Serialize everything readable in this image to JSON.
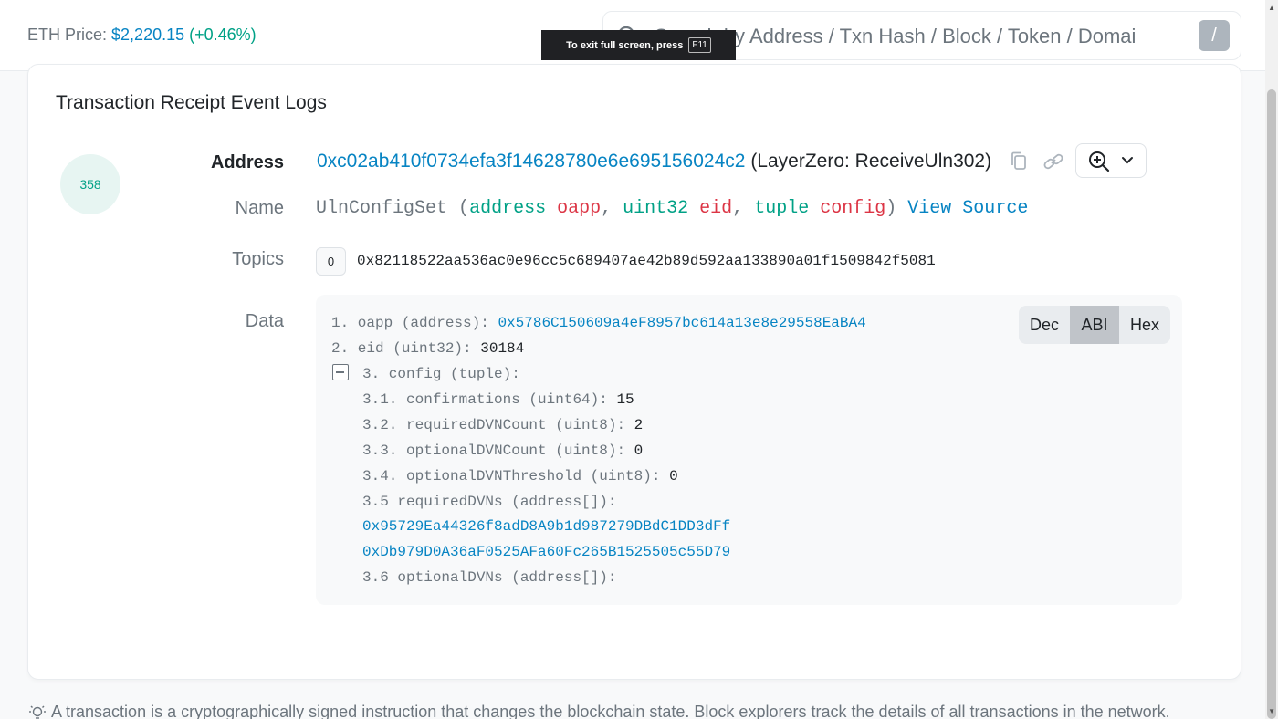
{
  "header": {
    "eth_price_label": "ETH Price:",
    "eth_price_value": "$2,220.15",
    "eth_price_change": "(+0.46%)",
    "search_placeholder": "Search by Address / Txn Hash / Block / Token / Domai",
    "search_shortcut": "/"
  },
  "fullscreen_toast": {
    "text": "To exit full screen, press",
    "key": "F11"
  },
  "card": {
    "title": "Transaction Receipt Event Logs",
    "log_index": "358",
    "labels": {
      "address": "Address",
      "name": "Name",
      "topics": "Topics",
      "data": "Data"
    },
    "address": {
      "hash": "0xc02ab410f0734efa3f14628780e6e695156024c2",
      "tag": "(LayerZero: ReceiveUln302)"
    },
    "name": {
      "event": "UlnConfigSet",
      "open": "(",
      "t1": "address",
      "p1": "oapp",
      "c1": ",",
      "t2": "uint32",
      "p2": "eid",
      "c2": ",",
      "t3": "tuple",
      "p3": "config",
      "close": ")",
      "view_source": "View Source"
    },
    "topics": {
      "index": "0",
      "hash": "0x82118522aa536ac0e96cc5c689407ae42b89d592aa133890a01f1509842f5081"
    },
    "data": {
      "line1_label": "1. oapp (address):",
      "line1_value": "0x5786C150609a4eF8957bc614a13e8e29558EaBA4",
      "line2_label": "2. eid (uint32):",
      "line2_value": "30184",
      "line3_label": "3. config (tuple):",
      "line31_label": "3.1. confirmations (uint64):",
      "line31_value": "15",
      "line32_label": "3.2. requiredDVNCount (uint8):",
      "line32_value": "2",
      "line33_label": "3.3. optionalDVNCount (uint8):",
      "line33_value": "0",
      "line34_label": "3.4. optionalDVNThreshold (uint8):",
      "line34_value": "0",
      "line35_label": "3.5 requiredDVNs (address[]):",
      "line35_values": [
        "0x95729Ea44326f8adD8A9b1d987279DBdC1DD3dFf",
        "0xDb979D0A36aF0525AFa60Fc265B1525505c55D79"
      ],
      "line36_label": "3.6 optionalDVNs (address[]):",
      "format_options": [
        "Dec",
        "ABI",
        "Hex"
      ],
      "selected_format": "ABI"
    }
  },
  "footer": {
    "note": "A transaction is a cryptographically signed instruction that changes the blockchain state. Block explorers track the details of all transactions in the network."
  },
  "colors": {
    "link": "#0784c3",
    "positive": "#00a186",
    "param_name": "#dc3545"
  }
}
